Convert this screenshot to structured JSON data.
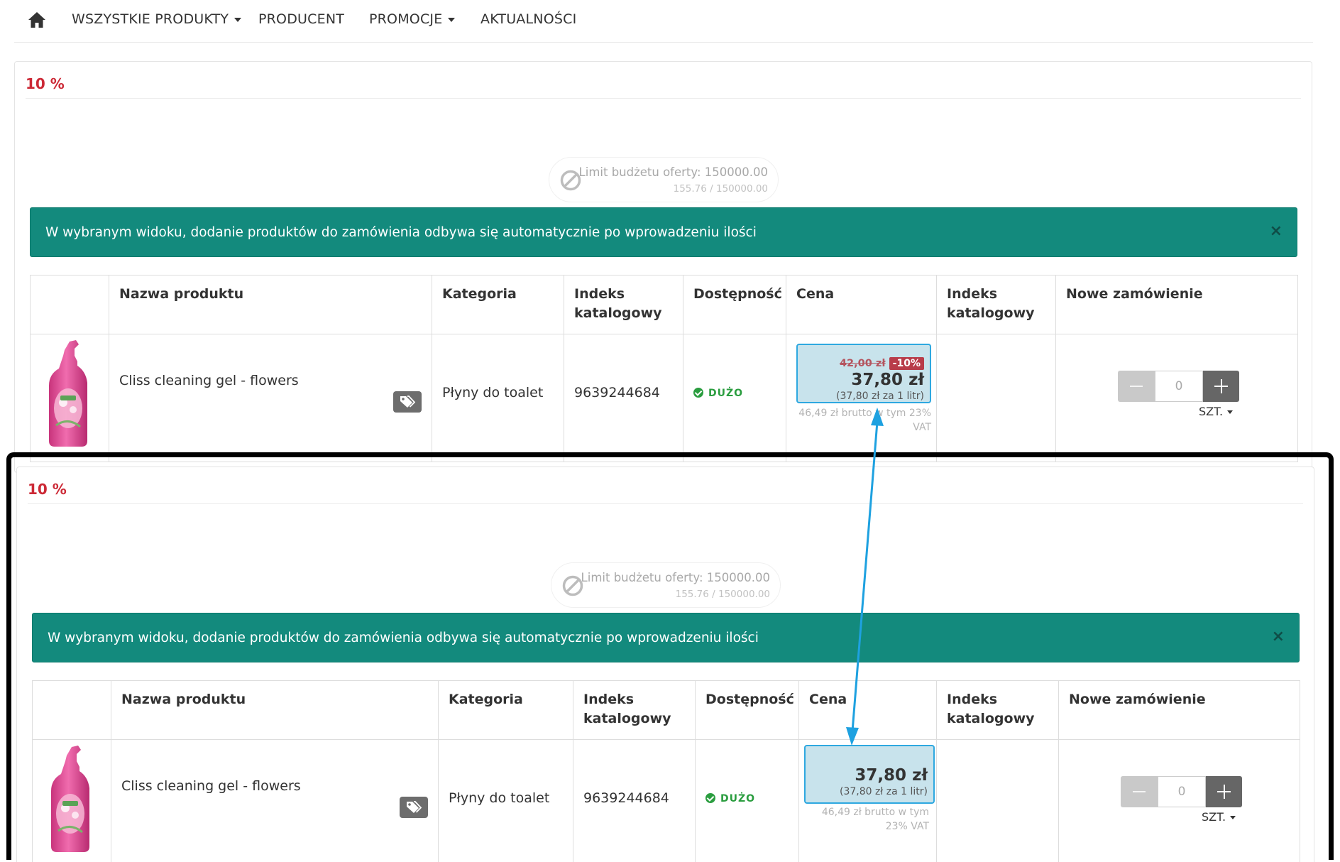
{
  "nav": {
    "items": [
      {
        "label": "WSZYSTKIE PRODUKTY",
        "dropdown": true
      },
      {
        "label": "PRODUCENT",
        "dropdown": false
      },
      {
        "label": "PROMOCJE",
        "dropdown": true
      },
      {
        "label": "AKTUALNOŚCI",
        "dropdown": false
      }
    ]
  },
  "icons": {
    "home": "home-icon",
    "ban": "ban-icon",
    "tag": "tags-icon",
    "check": "check-circle-icon",
    "close": "close-icon"
  },
  "colors": {
    "promo_title": "#cc2936",
    "alert_bg": "#138a7d",
    "price_box_bg": "#c8e3ec",
    "price_box_border": "#2ea8e0",
    "discount_badge": "#b83c4a",
    "availability": "#2a9d3f",
    "arrow": "#1ea1e0"
  },
  "sections": [
    {
      "promo_title": "10 %",
      "budget": {
        "title": "Limit budżetu oferty: 150000.00",
        "usage": "155.76 / 150000.00"
      },
      "alert": {
        "text": "W wybranym widoku, dodanie produktów do zamówienia odbywa się automatycznie po wprowadzeniu ilości",
        "close": "×"
      },
      "table": {
        "headers": [
          "",
          "Nazwa produktu",
          "Kategoria",
          "Indeks katalogowy",
          "Dostępność",
          "Cena",
          "Indeks katalogowy",
          "Nowe zamówienie"
        ],
        "row": {
          "name": "Cliss cleaning gel - flowers",
          "category": "Płyny do toalet",
          "index": "9639244684",
          "availability": "DUŻO",
          "old_price": "42,00 zł",
          "discount": "-10%",
          "price": "37,80 zł",
          "unit_price": "(37,80 zł  za 1 litr)",
          "gross": "46,49 zł brutto w tym 23% VAT",
          "quantity": "0",
          "unit": "SZT."
        }
      }
    },
    {
      "promo_title": "10 %",
      "budget": {
        "title": "Limit budżetu oferty: 150000.00",
        "usage": "155.76 / 150000.00"
      },
      "alert": {
        "text": "W wybranym widoku, dodanie produktów do zamówienia odbywa się automatycznie po wprowadzeniu ilości",
        "close": "×"
      },
      "table": {
        "headers": [
          "",
          "Nazwa produktu",
          "Kategoria",
          "Indeks katalogowy",
          "Dostępność",
          "Cena",
          "Indeks katalogowy",
          "Nowe zamówienie"
        ],
        "row": {
          "name": "Cliss cleaning gel - flowers",
          "category": "Płyny do toalet",
          "index": "9639244684",
          "availability": "DUŻO",
          "price": "37,80 zł",
          "unit_price": "(37,80 zł  za 1 litr)",
          "gross": "46,49 zł brutto w tym 23% VAT",
          "quantity": "0",
          "unit": "SZT."
        }
      }
    }
  ]
}
